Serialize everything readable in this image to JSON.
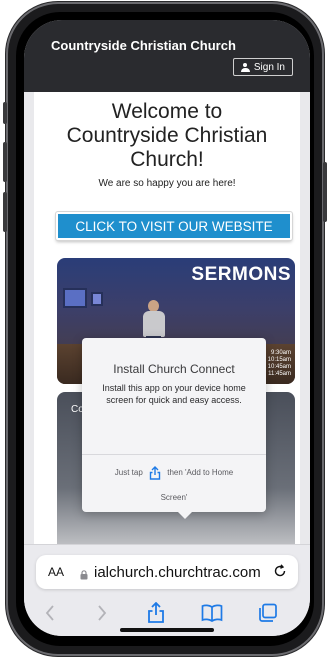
{
  "app": {
    "title": "Countryside Christian Church",
    "sign_in_label": "Sign In"
  },
  "main": {
    "welcome_text": "Welcome to Countryside Christian Church!",
    "tagline": "We are so happy you are here!",
    "visit_button_label": "CLICK TO VISIT OUR WEBSITE",
    "sermons_card": {
      "label": "SERMONS",
      "times": [
        "9:30am",
        "10:15am",
        "10:45am",
        "11:45am"
      ]
    },
    "second_card": {
      "label_partial": "Co"
    }
  },
  "install_popup": {
    "title": "Install Church Connect",
    "message": "Install this app on your device home screen for quick and easy access.",
    "step_part1": "Just tap",
    "step_part2": "then 'Add to Home",
    "step_part3": "Screen'"
  },
  "browser": {
    "text_size_label": "AA",
    "url_display": "ialchurch.churchtrac.com",
    "icons": [
      "back-icon",
      "forward-icon",
      "share-icon",
      "bookmarks-icon",
      "tabs-icon",
      "reload-icon",
      "lock-icon"
    ],
    "accent_color": "#1e7ae6"
  },
  "colors": {
    "header_bg": "#2a2b2f",
    "visit_button_bg": "#1f8fcd"
  }
}
